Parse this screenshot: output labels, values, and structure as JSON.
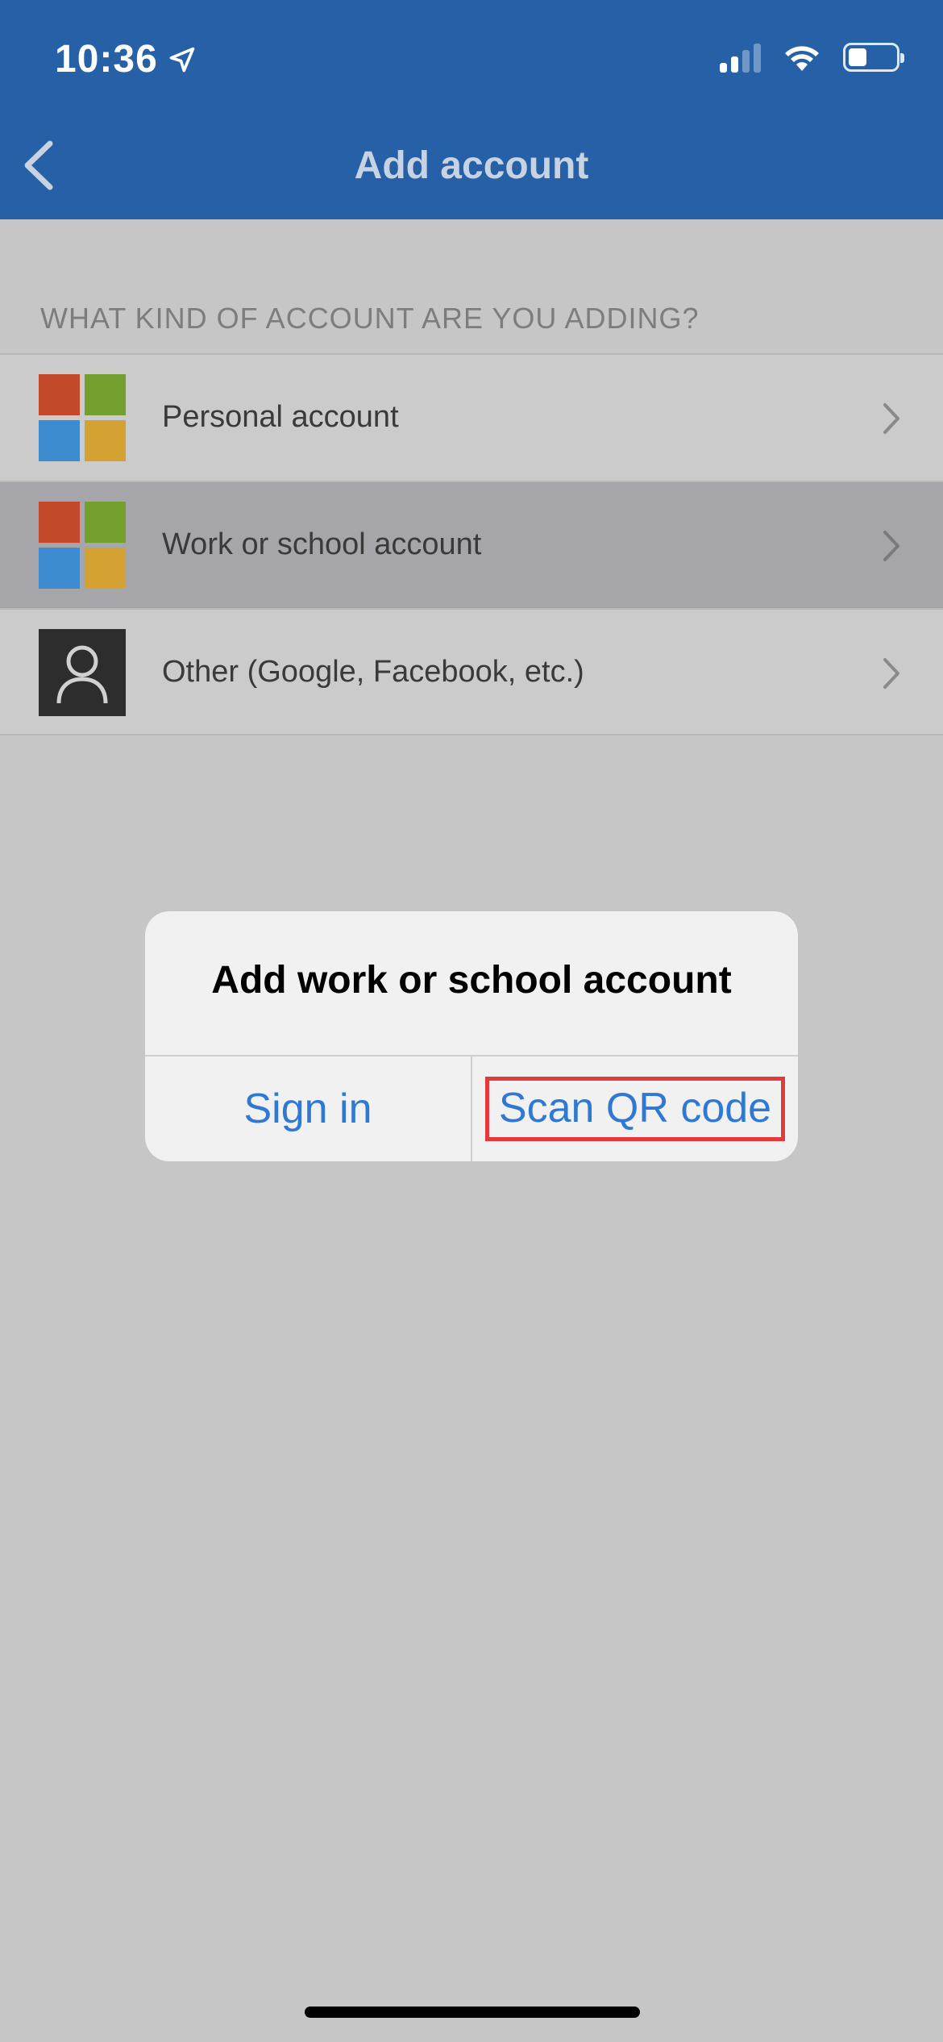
{
  "status_bar": {
    "time": "10:36",
    "location_icon": "location-arrow-icon",
    "signal_icon": "cellular-signal-icon",
    "wifi_icon": "wifi-icon",
    "battery_icon": "battery-icon"
  },
  "nav": {
    "back_icon": "chevron-left-icon",
    "title": "Add account"
  },
  "section": {
    "header": "WHAT KIND OF ACCOUNT ARE YOU ADDING?",
    "items": [
      {
        "label": "Personal account",
        "icon": "microsoft-logo-icon"
      },
      {
        "label": "Work or school account",
        "icon": "microsoft-logo-icon"
      },
      {
        "label": "Other (Google, Facebook, etc.)",
        "icon": "person-icon"
      }
    ]
  },
  "dialog": {
    "title": "Add work or school account",
    "sign_in_label": "Sign in",
    "scan_qr_label": "Scan QR code"
  },
  "colors": {
    "header_bg": "#2660a7",
    "link_blue": "#2f78d3",
    "ms_red": "#c2492a",
    "ms_green": "#739f2d",
    "ms_blue": "#3d8ccf",
    "ms_yellow": "#d3a232",
    "highlight_border": "#e03a3a"
  }
}
